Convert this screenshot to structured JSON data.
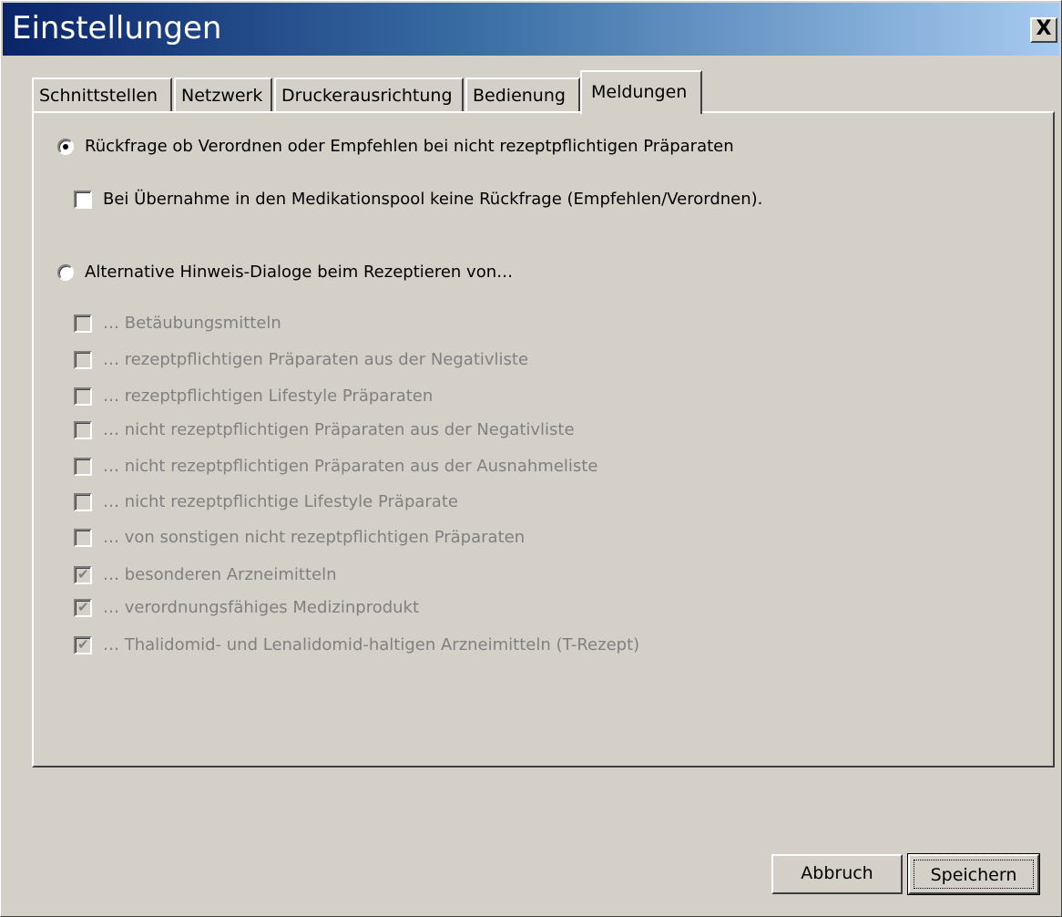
{
  "window": {
    "title": "Einstellungen",
    "close_label": "X"
  },
  "tabs": [
    {
      "label": "Schnittstellen",
      "active": false
    },
    {
      "label": "Netzwerk",
      "active": false
    },
    {
      "label": "Druckerausrichtung",
      "active": false
    },
    {
      "label": "Bedienung",
      "active": false
    },
    {
      "label": "Meldungen",
      "active": true
    }
  ],
  "options": {
    "radio_confirm": {
      "label": "Rückfrage ob Verordnen oder Empfehlen bei nicht rezeptpflichtigen Präparaten",
      "checked": true
    },
    "checkbox_pool": {
      "label": "Bei Übernahme in den Medikationspool keine Rückfrage (Empfehlen/Verordnen).",
      "checked": false
    },
    "radio_alternative": {
      "label": "Alternative Hinweis-Dialoge beim Rezeptieren von…",
      "checked": false
    },
    "alternative_items": [
      {
        "label": "… Betäubungsmitteln",
        "checked": false
      },
      {
        "label": "… rezeptpflichtigen Präparaten aus der Negativliste",
        "checked": false
      },
      {
        "label": "… rezeptpflichtigen Lifestyle Präparaten",
        "checked": false
      },
      {
        "label": "… nicht rezeptpflichtigen Präparaten aus der Negativliste",
        "checked": false
      },
      {
        "label": "… nicht rezeptpflichtigen Präparaten aus der Ausnahmeliste",
        "checked": false
      },
      {
        "label": "… nicht rezeptpflichtige Lifestyle Präparate",
        "checked": false
      },
      {
        "label": "… von sonstigen nicht rezeptpflichtigen Präparaten",
        "checked": false
      },
      {
        "label": "… besonderen Arzneimitteln",
        "checked": true
      },
      {
        "label": "… verordnungsfähiges Medizinprodukt",
        "checked": true
      },
      {
        "label": "… Thalidomid- und Lenalidomid-haltigen Arzneimitteln (T-Rezept)",
        "checked": true
      }
    ]
  },
  "buttons": {
    "cancel_label": "Abbruch",
    "save_label": "Speichern"
  }
}
